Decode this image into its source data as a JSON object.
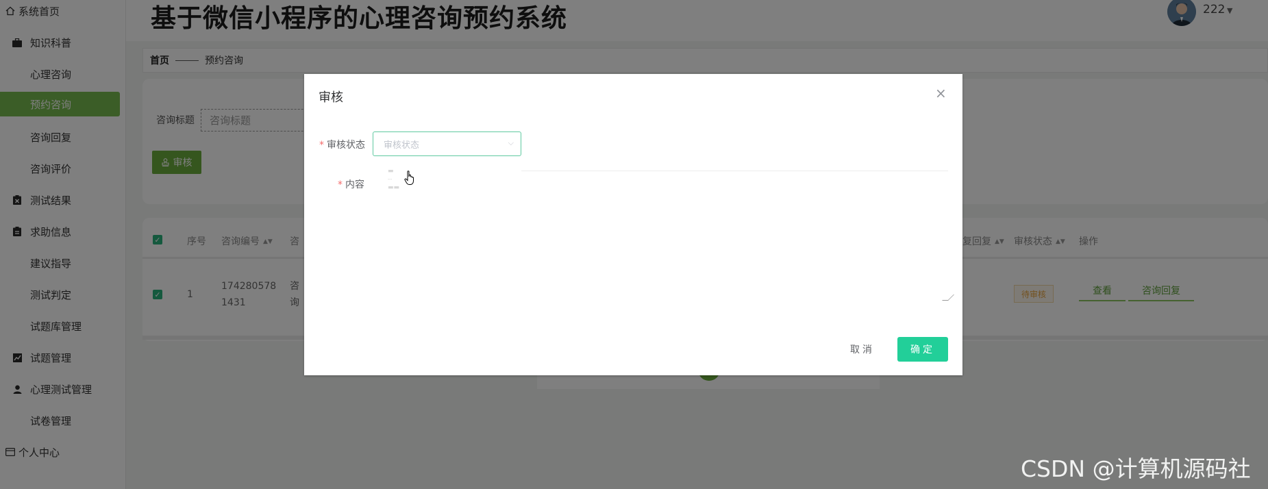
{
  "app": {
    "title": "基于微信小程序的心理咨询预约系统"
  },
  "header": {
    "user_name": "222"
  },
  "sidebar": {
    "home_label": "系统首页",
    "items": [
      {
        "label": "知识科普",
        "icon": "briefcase-icon"
      },
      {
        "label": "心理咨询",
        "icon": "grid-icon"
      },
      {
        "label": "预约咨询",
        "icon": "grid-icon",
        "active": true
      },
      {
        "label": "咨询回复",
        "icon": "grid-icon"
      },
      {
        "label": "咨询评价",
        "icon": "grid-icon"
      },
      {
        "label": "测试结果",
        "icon": "clipboard-x-icon"
      },
      {
        "label": "求助信息",
        "icon": "clipboard-icon"
      },
      {
        "label": "建议指导",
        "icon": "grid-icon"
      },
      {
        "label": "测试判定",
        "icon": "grid-icon"
      },
      {
        "label": "试题库管理",
        "icon": "grid-icon"
      },
      {
        "label": "试题管理",
        "icon": "line-chart-icon"
      },
      {
        "label": "心理测试管理",
        "icon": "person-icon"
      },
      {
        "label": "试卷管理",
        "icon": "grid-icon"
      }
    ],
    "profile_label": "个人中心"
  },
  "breadcrumb": {
    "home": "首页",
    "current": "预约咨询"
  },
  "search": {
    "label": "咨询标题",
    "placeholder": "咨询标题"
  },
  "toolbar": {
    "audit_label": "审核"
  },
  "table": {
    "headers": {
      "index": "序号",
      "code": "咨询编号",
      "title_partial": "咨",
      "reply_partial": "复回复",
      "status": "审核状态",
      "actions": "操作"
    },
    "rows": [
      {
        "index": "1",
        "code_line1": "174280578",
        "code_line2": "1431",
        "title_line1": "咨",
        "title_line2": "询",
        "status": "待审核",
        "view_label": "查看",
        "reply_label": "咨询回复"
      }
    ]
  },
  "dialog": {
    "title": "审核",
    "status_label": "审核状态",
    "status_placeholder": "审核状态",
    "content_label": "内容",
    "cancel_label": "取消",
    "ok_label": "确定"
  },
  "watermark": "CSDN @计算机源码社",
  "colors": {
    "accent_green": "#77ba4e",
    "confirm_teal": "#22cf99",
    "pending_orange": "#e6a23c"
  }
}
